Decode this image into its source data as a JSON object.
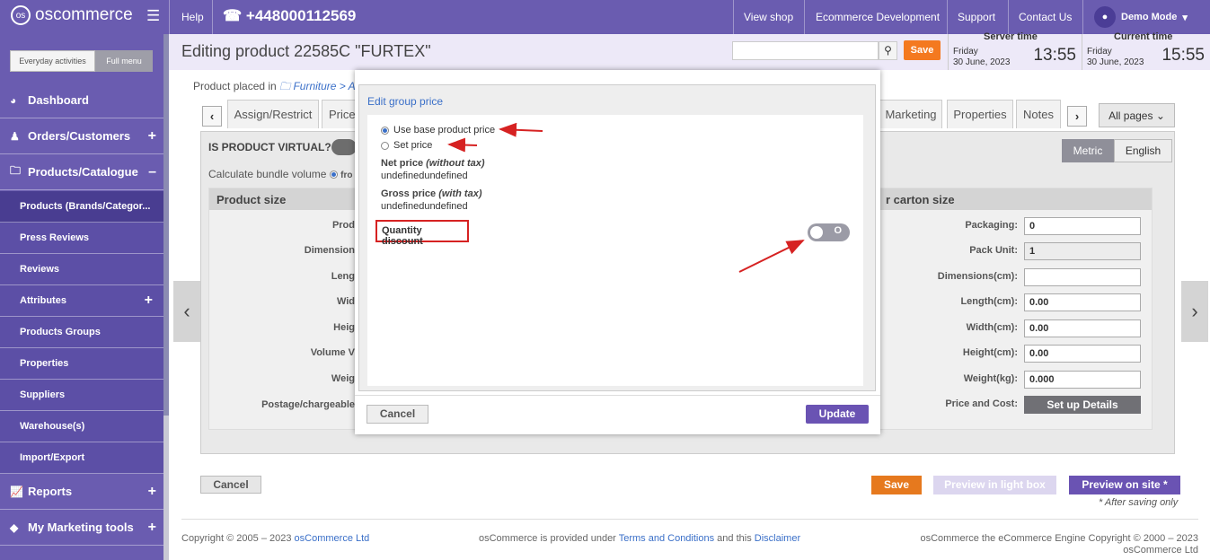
{
  "topbar": {
    "brand": "oscommerce",
    "help": "Help",
    "phone": "+448000112569",
    "links": [
      "View shop",
      "Ecommerce Development",
      "Support",
      "Contact Us"
    ],
    "user": "Demo Mode"
  },
  "sidebar": {
    "tabs": [
      "Everyday activities",
      "Full menu"
    ],
    "items": [
      {
        "label": "Dashboard"
      },
      {
        "label": "Orders/Customers"
      },
      {
        "label": "Products/Catalogue"
      },
      {
        "label": "Products (Brands/Categor..."
      },
      {
        "label": "Press Reviews"
      },
      {
        "label": "Reviews"
      },
      {
        "label": "Attributes"
      },
      {
        "label": "Products Groups"
      },
      {
        "label": "Properties"
      },
      {
        "label": "Suppliers"
      },
      {
        "label": "Warehouse(s)"
      },
      {
        "label": "Import/Export"
      },
      {
        "label": "Reports"
      },
      {
        "label": "My Marketing tools"
      }
    ]
  },
  "header": {
    "title": "Editing product 22585C \"FURTEX\"",
    "search_placeholder": "",
    "save_label": "Save",
    "server_time": {
      "label": "Server time",
      "day": "Friday",
      "date": "30 June, 2023",
      "time": "13:55"
    },
    "current_time": {
      "label": "Current time",
      "day": "Friday",
      "date": "30 June, 2023",
      "time": "15:55"
    }
  },
  "main": {
    "placed_prefix": "Product placed in",
    "breadcrumb": "Furniture > Ac",
    "tabs": [
      "Assign/Restrict",
      "Price",
      "Marketing",
      "Properties",
      "Notes"
    ],
    "all_pages": "All pages",
    "virtual_label": "IS PRODUCT VIRTUAL?",
    "calc_bundle": "Calculate bundle volume",
    "calc_bundle_option": "fro",
    "units": [
      "Metric",
      "English"
    ],
    "product_size_title": "Product size",
    "product_size_labels": [
      "Prod",
      "Dimension",
      "Leng",
      "Wid",
      "Heig",
      "Volume V",
      "Weig",
      "Postage/chargeable"
    ],
    "carton_title": "r carton size",
    "carton_fields": [
      {
        "label": "Packaging:",
        "value": "0"
      },
      {
        "label": "Pack Unit:",
        "value": "1"
      },
      {
        "label": "Dimensions(cm):",
        "value": ""
      },
      {
        "label": "Length(cm):",
        "value": "0.00"
      },
      {
        "label": "Width(cm):",
        "value": "0.00"
      },
      {
        "label": "Height(cm):",
        "value": "0.00"
      },
      {
        "label": "Weight(kg):",
        "value": "0.000"
      }
    ],
    "price_cost_label": "Price and Cost:",
    "setup_details": "Set up Details",
    "cancel": "Cancel",
    "save": "Save",
    "preview_lightbox": "Preview in light box",
    "preview_site": "Preview on site *",
    "after_saving": "* After saving only"
  },
  "modal": {
    "title": "Edit group price",
    "use_base": "Use base product price",
    "set_price": "Set price",
    "net_label": "Net price",
    "net_note": "(without tax)",
    "net_value": "undefinedundefined",
    "gross_label": "Gross price",
    "gross_note": "(with tax)",
    "gross_value": "undefinedundefined",
    "quantity_discount": "Quantity discount",
    "toggle_text": "O",
    "cancel": "Cancel",
    "update": "Update"
  },
  "footer": {
    "copyright": "Copyright © 2005 – 2023",
    "copyright_link": "osCommerce Ltd",
    "mid_text": "osCommerce is provided under",
    "terms": "Terms and Conditions",
    "and_this": "and this",
    "disclaimer": "Disclaimer",
    "right": "osCommerce the eCommerce Engine Copyright © 2000 – 2023 osCommerce Ltd"
  },
  "colors": {
    "accent": "#6a5cb0",
    "orange": "#f47920",
    "annotation": "#d62222"
  }
}
